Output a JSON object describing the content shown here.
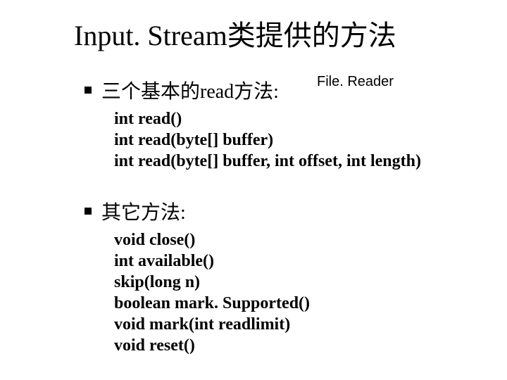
{
  "title": "Input. Stream类提供的方法",
  "annotation": "File. Reader",
  "section1": {
    "heading": "三个基本的read方法:",
    "items": [
      "int read()",
      "int read(byte[] buffer)",
      "int read(byte[] buffer, int offset, int length)"
    ]
  },
  "section2": {
    "heading": "其它方法:",
    "items": [
      "void close()",
      "int available()",
      "skip(long n)",
      "boolean mark. Supported()",
      "void mark(int readlimit)",
      "void reset()"
    ]
  }
}
